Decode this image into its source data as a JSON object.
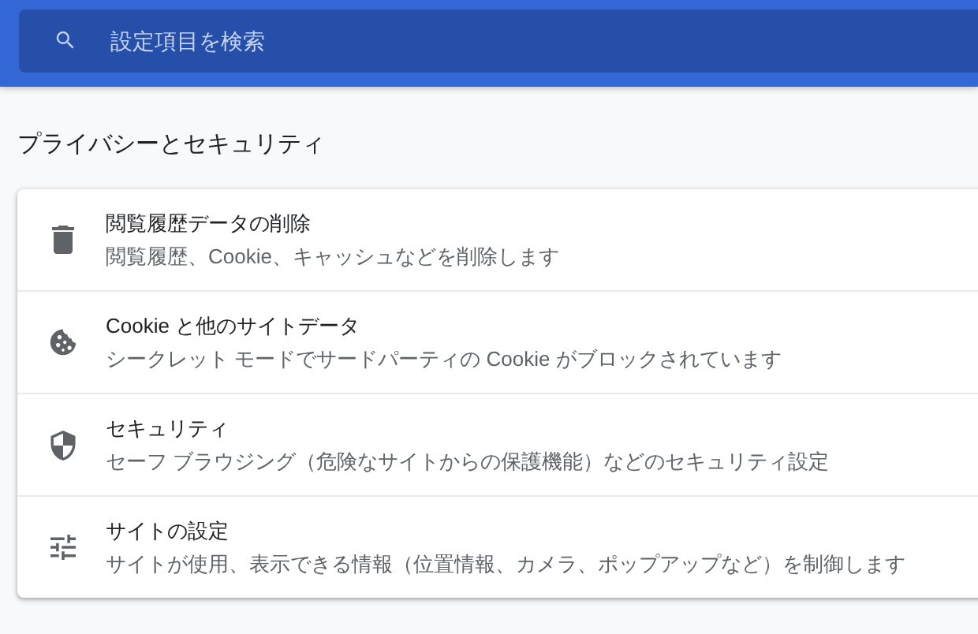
{
  "search": {
    "placeholder": "設定項目を検索"
  },
  "section_title": "プライバシーとセキュリティ",
  "items": [
    {
      "kind": "trash",
      "title": "閲覧履歴データの削除",
      "description": "閲覧履歴、Cookie、キャッシュなどを削除します"
    },
    {
      "kind": "cookie",
      "title": "Cookie と他のサイトデータ",
      "description": "シークレット モードでサードパーティの Cookie がブロックされています"
    },
    {
      "kind": "shield",
      "title": "セキュリティ",
      "description": "セーフ ブラウジング（危険なサイトからの保護機能）などのセキュリティ設定"
    },
    {
      "kind": "tune",
      "title": "サイトの設定",
      "description": "サイトが使用、表示できる情報（位置情報、カメラ、ポップアップなど）を制御します"
    }
  ]
}
